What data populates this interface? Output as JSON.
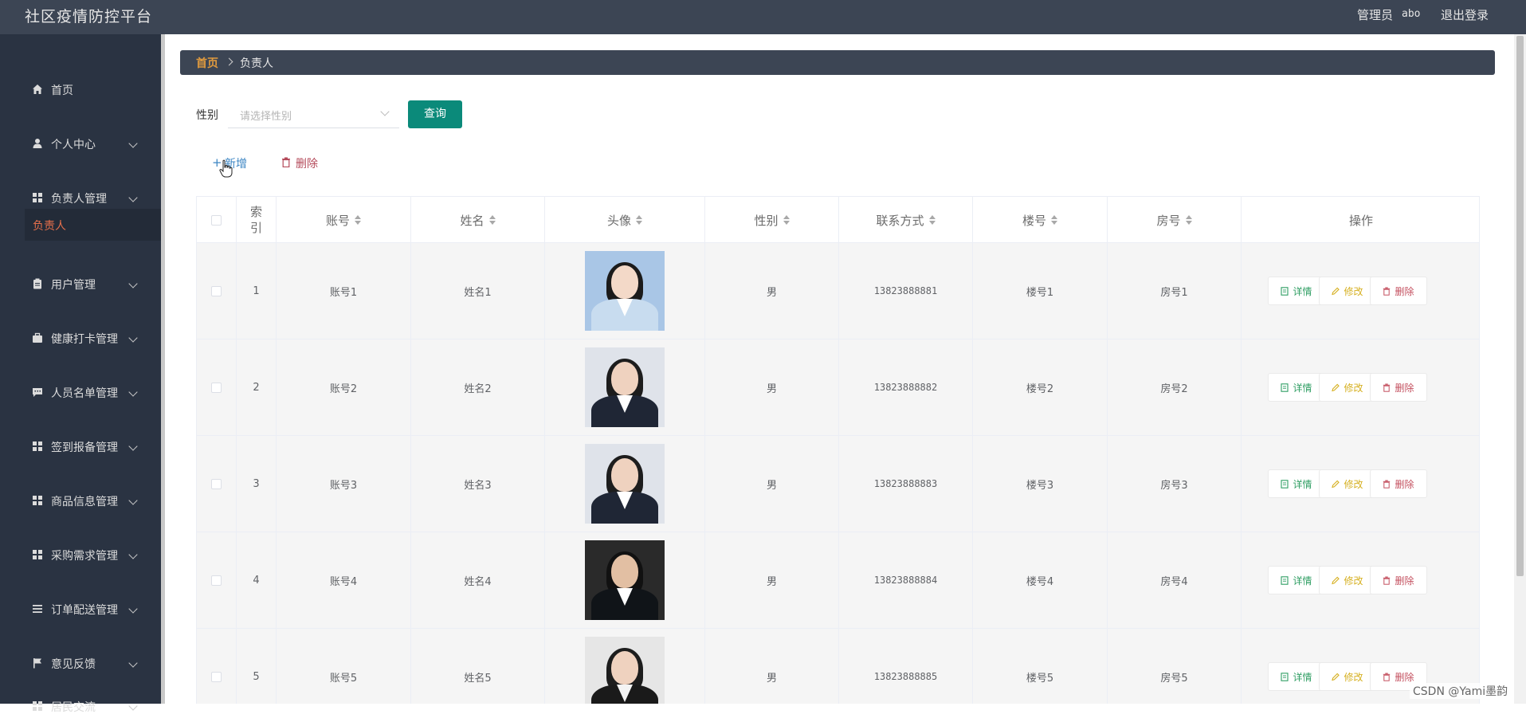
{
  "app": {
    "title": "社区疫情防控平台"
  },
  "topbar": {
    "admin_label": "管理员",
    "admin_name": "abo",
    "logout": "退出登录"
  },
  "sidebar": {
    "items": [
      {
        "label": "首页",
        "icon": "home-icon"
      },
      {
        "label": "个人中心",
        "icon": "user-icon"
      },
      {
        "label": "负责人管理",
        "icon": "grid-icon"
      },
      {
        "label": "用户管理",
        "icon": "clipboard-icon"
      },
      {
        "label": "健康打卡管理",
        "icon": "briefcase-icon"
      },
      {
        "label": "人员名单管理",
        "icon": "chat-icon"
      },
      {
        "label": "签到报备管理",
        "icon": "grid-icon"
      },
      {
        "label": "商品信息管理",
        "icon": "grid-icon"
      },
      {
        "label": "采购需求管理",
        "icon": "grid-icon"
      },
      {
        "label": "订单配送管理",
        "icon": "list-icon"
      },
      {
        "label": "意见反馈",
        "icon": "flag-icon"
      },
      {
        "label": "居民交流",
        "icon": "grid-icon"
      }
    ],
    "active_sub": "负责人"
  },
  "breadcrumb": {
    "home": "首页",
    "current": "负责人"
  },
  "filter": {
    "label": "性别",
    "placeholder": "请选择性别",
    "query": "查询"
  },
  "toolbar": {
    "add": "新增",
    "delete": "删除"
  },
  "table": {
    "headers": {
      "index": [
        "索",
        "引"
      ],
      "account": "账号",
      "name": "姓名",
      "avatar": "头像",
      "gender": "性别",
      "phone": "联系方式",
      "building": "楼号",
      "room": "房号",
      "ops": "操作"
    },
    "actions": {
      "detail": "详情",
      "edit": "修改",
      "delete": "删除"
    },
    "rows": [
      {
        "index": "1",
        "account": "账号1",
        "name": "姓名1",
        "gender": "男",
        "phone": "13823888881",
        "building": "楼号1",
        "room": "房号1"
      },
      {
        "index": "2",
        "account": "账号2",
        "name": "姓名2",
        "gender": "男",
        "phone": "13823888882",
        "building": "楼号2",
        "room": "房号2"
      },
      {
        "index": "3",
        "account": "账号3",
        "name": "姓名3",
        "gender": "男",
        "phone": "13823888883",
        "building": "楼号3",
        "room": "房号3"
      },
      {
        "index": "4",
        "account": "账号4",
        "name": "姓名4",
        "gender": "男",
        "phone": "13823888884",
        "building": "楼号4",
        "room": "房号4"
      },
      {
        "index": "5",
        "account": "账号5",
        "name": "姓名5",
        "gender": "男",
        "phone": "13823888885",
        "building": "楼号5",
        "room": "房号5"
      }
    ]
  },
  "watermark": "CSDN @Yami墨韵",
  "colors": {
    "topbar": "#3c4554",
    "sidebar": "#2a3342",
    "accent": "#0b8a7a",
    "active": "#e56f4b"
  }
}
